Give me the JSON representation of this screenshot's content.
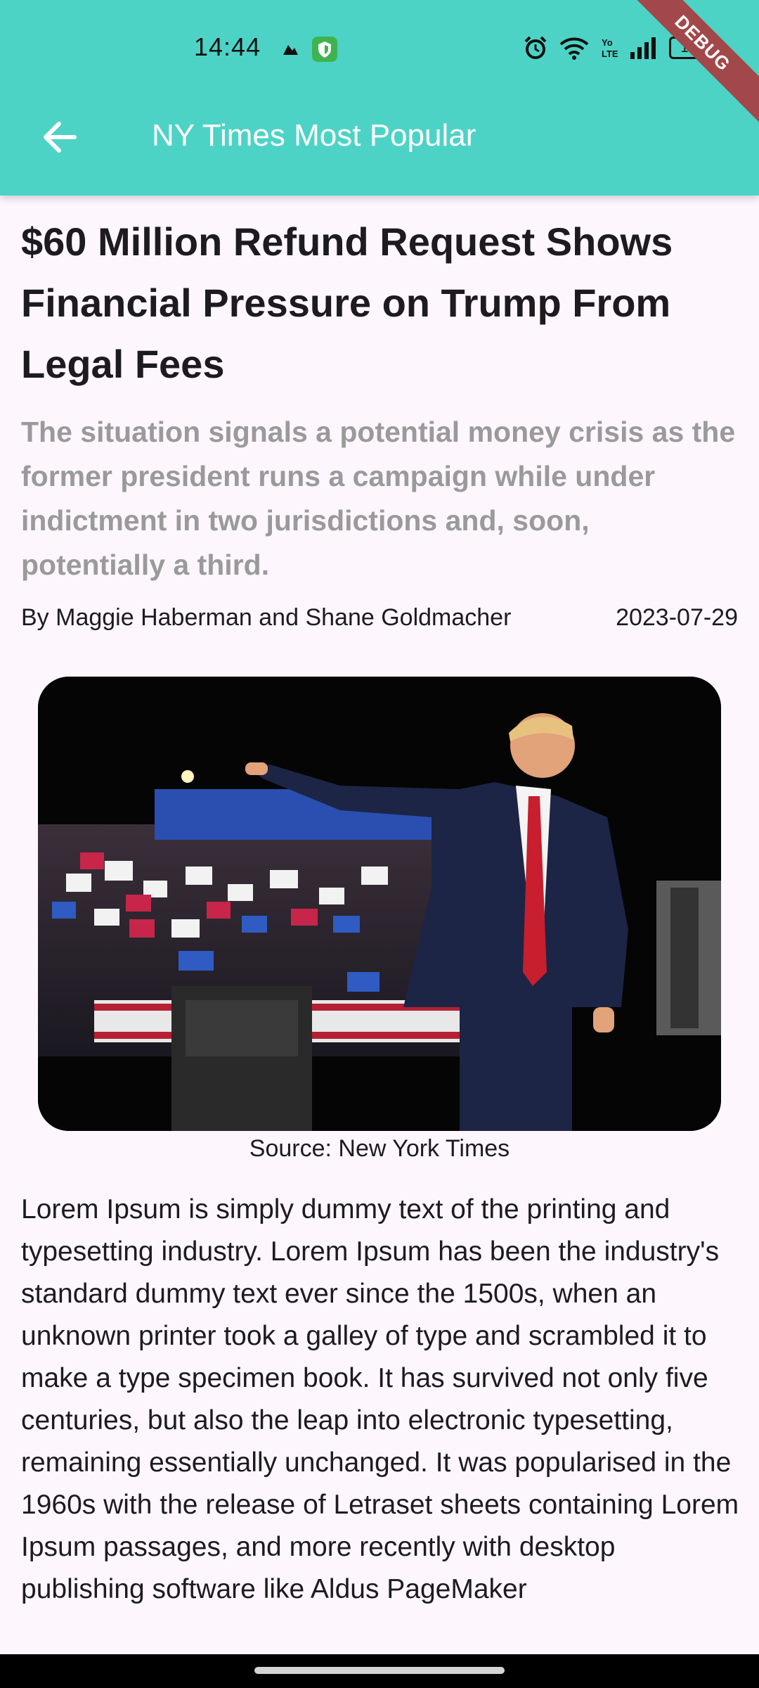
{
  "status_bar": {
    "time": "14:44",
    "battery": "100",
    "icons": [
      "notification-icon",
      "vpn-shield-icon",
      "alarm-icon",
      "wifi-icon",
      "volte-icon",
      "signal-icon",
      "battery-icon"
    ]
  },
  "debug_banner": "DEBUG",
  "app_bar": {
    "title": "NY Times Most Popular",
    "back_icon": "arrow-back-icon",
    "color": "#4dd3c5"
  },
  "article": {
    "title": "$60 Million Refund Request Shows Financial Pressure on Trump From Legal Fees",
    "abstract": "The situation signals a potential money crisis as the former president runs a campaign while under indictment in two jurisdictions and, soon, potentially a third.",
    "byline": "By Maggie Haberman and Shane Goldmacher",
    "date": "2023-07-29",
    "image_caption": "Source: New York Times",
    "body": "Lorem Ipsum is simply dummy text of the printing and typesetting industry. Lorem Ipsum has been the industry's standard dummy text ever since the 1500s, when an unknown printer took a galley of type and scrambled it to make a type specimen book. It has survived not only five centuries, but also the leap into electronic typesetting, remaining essentially unchanged. It was popularised in the 1960s with the release of Letraset sheets containing Lorem Ipsum passages, and more recently with desktop publishing software like Aldus PageMaker"
  }
}
